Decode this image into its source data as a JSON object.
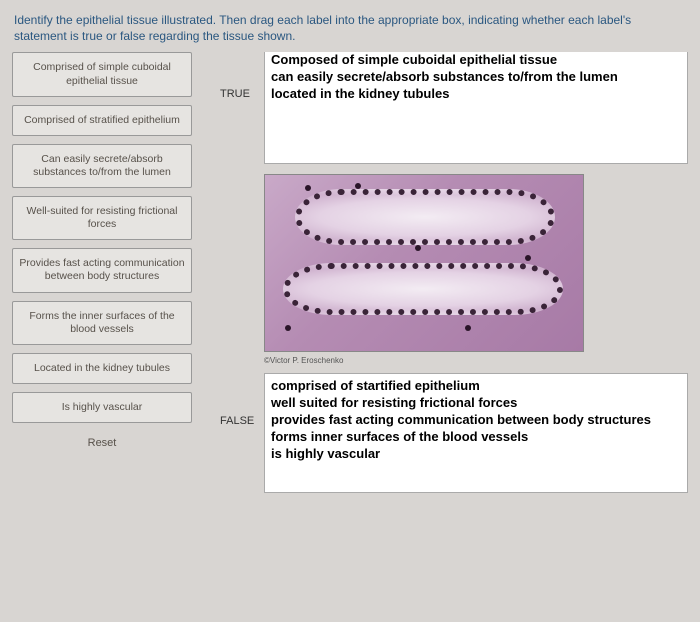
{
  "instructions": "Identify the epithelial tissue illustrated. Then drag each label into the appropriate box, indicating whether each label's statement is true or false regarding the tissue shown.",
  "labels": {
    "l0": "Comprised of simple cuboidal epithelial tissue",
    "l1": "Comprised of stratified epithelium",
    "l2": "Can easily secrete/absorb substances to/from the lumen",
    "l3": "Well-suited for resisting frictional forces",
    "l4": "Provides fast acting communication between body structures",
    "l5": "Forms the inner surfaces of the blood vessels",
    "l6": "Located in the kidney tubules",
    "l7": "Is highly vascular"
  },
  "reset_label": "Reset",
  "true_header": "TRUE",
  "false_header": "FALSE",
  "image_credit": "©Victor P. Eroschenko",
  "true_box": {
    "line0": "Composed of simple cuboidal epithelial tissue",
    "line1": "can easily secrete/absorb substances to/from the lumen",
    "line2": "located in the kidney tubules"
  },
  "false_box": {
    "line0": "comprised of startified epithelium",
    "line1": "well suited for resisting frictional forces",
    "line2": "provides fast acting communication between body structures",
    "line3": "forms inner surfaces of the blood vessels",
    "line4": "is highly vascular"
  }
}
